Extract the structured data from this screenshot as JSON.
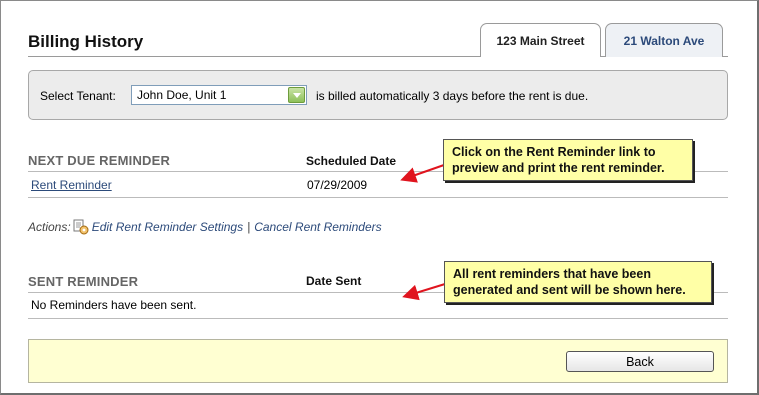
{
  "page": {
    "title": "Billing History"
  },
  "tabs": [
    {
      "label": "123 Main Street",
      "active": true
    },
    {
      "label": "21 Walton Ave",
      "active": false
    }
  ],
  "tenant": {
    "label": "Select Tenant:",
    "selected": "John Doe, Unit 1",
    "note": "is billed automatically 3 days before the rent is due."
  },
  "next_due": {
    "heading": "NEXT DUE REMINDER",
    "col_date": "Scheduled Date",
    "rows": [
      {
        "name": "Rent Reminder",
        "date": "07/29/2009"
      }
    ]
  },
  "actions": {
    "label": "Actions:",
    "edit": "Edit Rent Reminder Settings",
    "separator": "|",
    "cancel": "Cancel Rent Reminders"
  },
  "sent": {
    "heading": "SENT REMINDER",
    "col_date": "Date Sent",
    "empty": "No Reminders have been sent."
  },
  "callouts": {
    "top_line1": "Click on the Rent Reminder link to",
    "top_line2": "preview and print the rent reminder.",
    "bottom_line1": "All rent reminders that have been",
    "bottom_line2": "generated and sent will be shown here."
  },
  "footer": {
    "back_label": "Back"
  },
  "colors": {
    "link": "#2c4a7a",
    "callout_bg": "#ffffa6",
    "footer_bg": "#ffffd2",
    "arrow": "#e0141e"
  },
  "icons": {
    "actions": "gear-icon",
    "dropdown": "chevron-down-icon"
  }
}
